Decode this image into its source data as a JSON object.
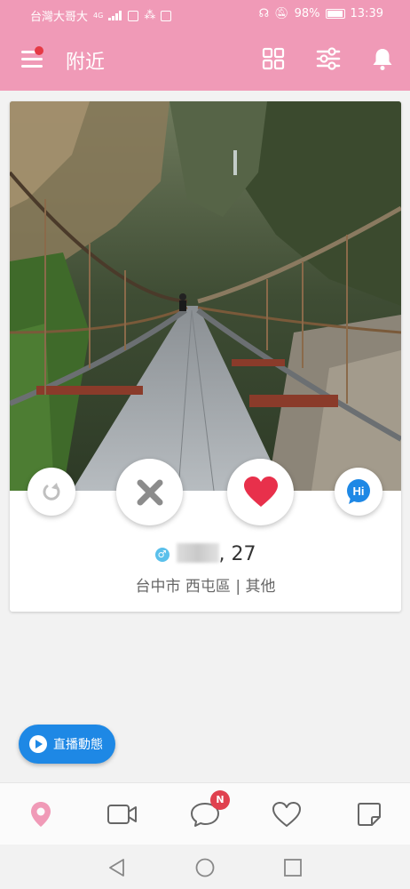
{
  "status_bar": {
    "carrier": "台灣大哥大",
    "network": "4G",
    "battery": "98%",
    "time": "13:39"
  },
  "app_bar": {
    "title": "附近",
    "menu_icon": "menu-icon",
    "grid_icon": "grid-icon",
    "filter_icon": "sliders-icon",
    "notification_icon": "bell-icon"
  },
  "profile": {
    "gender_symbol": "♂",
    "age": ", 27",
    "location": "台中市 西屯區 | 其他"
  },
  "actions": {
    "rewind_icon": "rewind-icon",
    "dislike_icon": "x-icon",
    "like_icon": "heart-icon",
    "hi_label": "Hi"
  },
  "live_button": {
    "label": "直播動態"
  },
  "bottom_nav": {
    "items": [
      "nearby",
      "video",
      "messages",
      "favorites",
      "notes"
    ],
    "messages_badge": "N"
  },
  "colors": {
    "brand_pink": "#f09ab7",
    "like_red": "#e8304b",
    "live_blue": "#1e88e5",
    "badge_red": "#e0414f"
  }
}
